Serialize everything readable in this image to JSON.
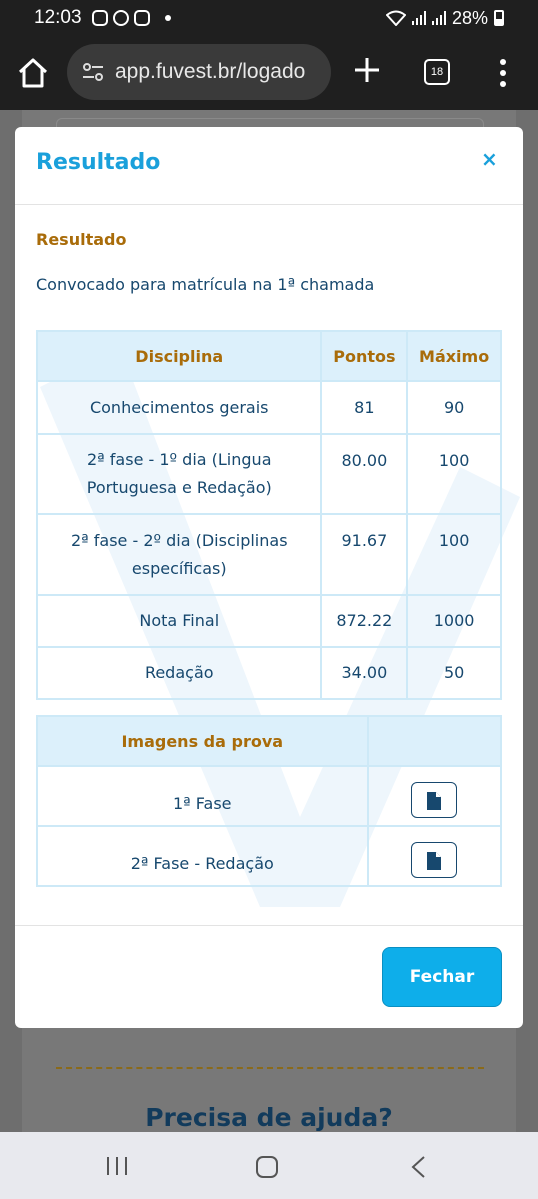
{
  "status_bar": {
    "time": "12:03",
    "battery": "28%"
  },
  "browser": {
    "url": "app.fuvest.br/logado",
    "tab_count": "18"
  },
  "modal": {
    "title": "Resultado",
    "close_label": "×",
    "section_label": "Resultado",
    "status": "Convocado para matrícula na 1ª chamada",
    "scores_table": {
      "headers": [
        "Disciplina",
        "Pontos",
        "Máximo"
      ],
      "rows": [
        {
          "disciplina": "Conhecimentos gerais",
          "pontos": "81",
          "maximo": "90"
        },
        {
          "disciplina": "2ª fase - 1º dia (Lingua Portuguesa e Redação)",
          "pontos": "80.00",
          "maximo": "100"
        },
        {
          "disciplina": "2ª fase - 2º dia (Disciplinas específicas)",
          "pontos": "91.67",
          "maximo": "100"
        },
        {
          "disciplina": "Nota Final",
          "pontos": "872.22",
          "maximo": "1000"
        },
        {
          "disciplina": "Redação",
          "pontos": "34.00",
          "maximo": "50"
        }
      ]
    },
    "images_table": {
      "header": "Imagens da prova",
      "rows": [
        {
          "label": "1ª Fase"
        },
        {
          "label": "2ª Fase - Redação"
        }
      ]
    },
    "close_button": "Fechar"
  },
  "background_page": {
    "help_title": "Precisa de ajuda?"
  }
}
